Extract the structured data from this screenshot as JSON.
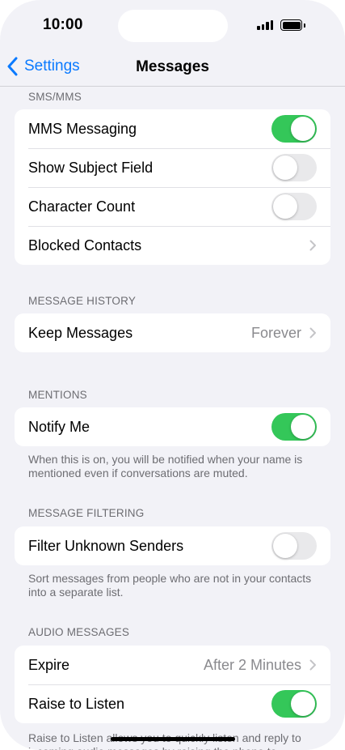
{
  "status_bar": {
    "time": "10:00"
  },
  "nav": {
    "back_label": "Settings",
    "title": "Messages"
  },
  "sms_mms": {
    "header": "SMS/MMS",
    "rows": [
      {
        "label": "MMS Messaging",
        "toggle": true
      },
      {
        "label": "Show Subject Field",
        "toggle": false
      },
      {
        "label": "Character Count",
        "toggle": false
      },
      {
        "label": "Blocked Contacts"
      }
    ]
  },
  "message_history": {
    "header": "MESSAGE HISTORY",
    "keep_messages": {
      "label": "Keep Messages",
      "value": "Forever"
    }
  },
  "mentions": {
    "header": "MENTIONS",
    "notify_me": {
      "label": "Notify Me",
      "toggle": true
    },
    "footer": "When this is on, you will be notified when your name is mentioned even if conversations are muted."
  },
  "message_filtering": {
    "header": "MESSAGE FILTERING",
    "filter_unknown": {
      "label": "Filter Unknown Senders",
      "toggle": false
    },
    "footer": "Sort messages from people who are not in your contacts into a separate list."
  },
  "audio_messages": {
    "header": "AUDIO MESSAGES",
    "expire": {
      "label": "Expire",
      "value": "After 2 Minutes"
    },
    "raise_to_listen": {
      "label": "Raise to Listen",
      "toggle": true
    },
    "footer": "Raise to Listen allows you to quickly listen and reply to incoming audio messages by raising the phone to"
  },
  "colors": {
    "accent": "#0a7aff",
    "toggle_on": "#34c759",
    "toggle_off": "#e9e9eb",
    "background": "#f2f2f7"
  },
  "icons": [
    "chevron-left-icon",
    "chevron-right-icon",
    "signal-icon",
    "battery-icon"
  ]
}
